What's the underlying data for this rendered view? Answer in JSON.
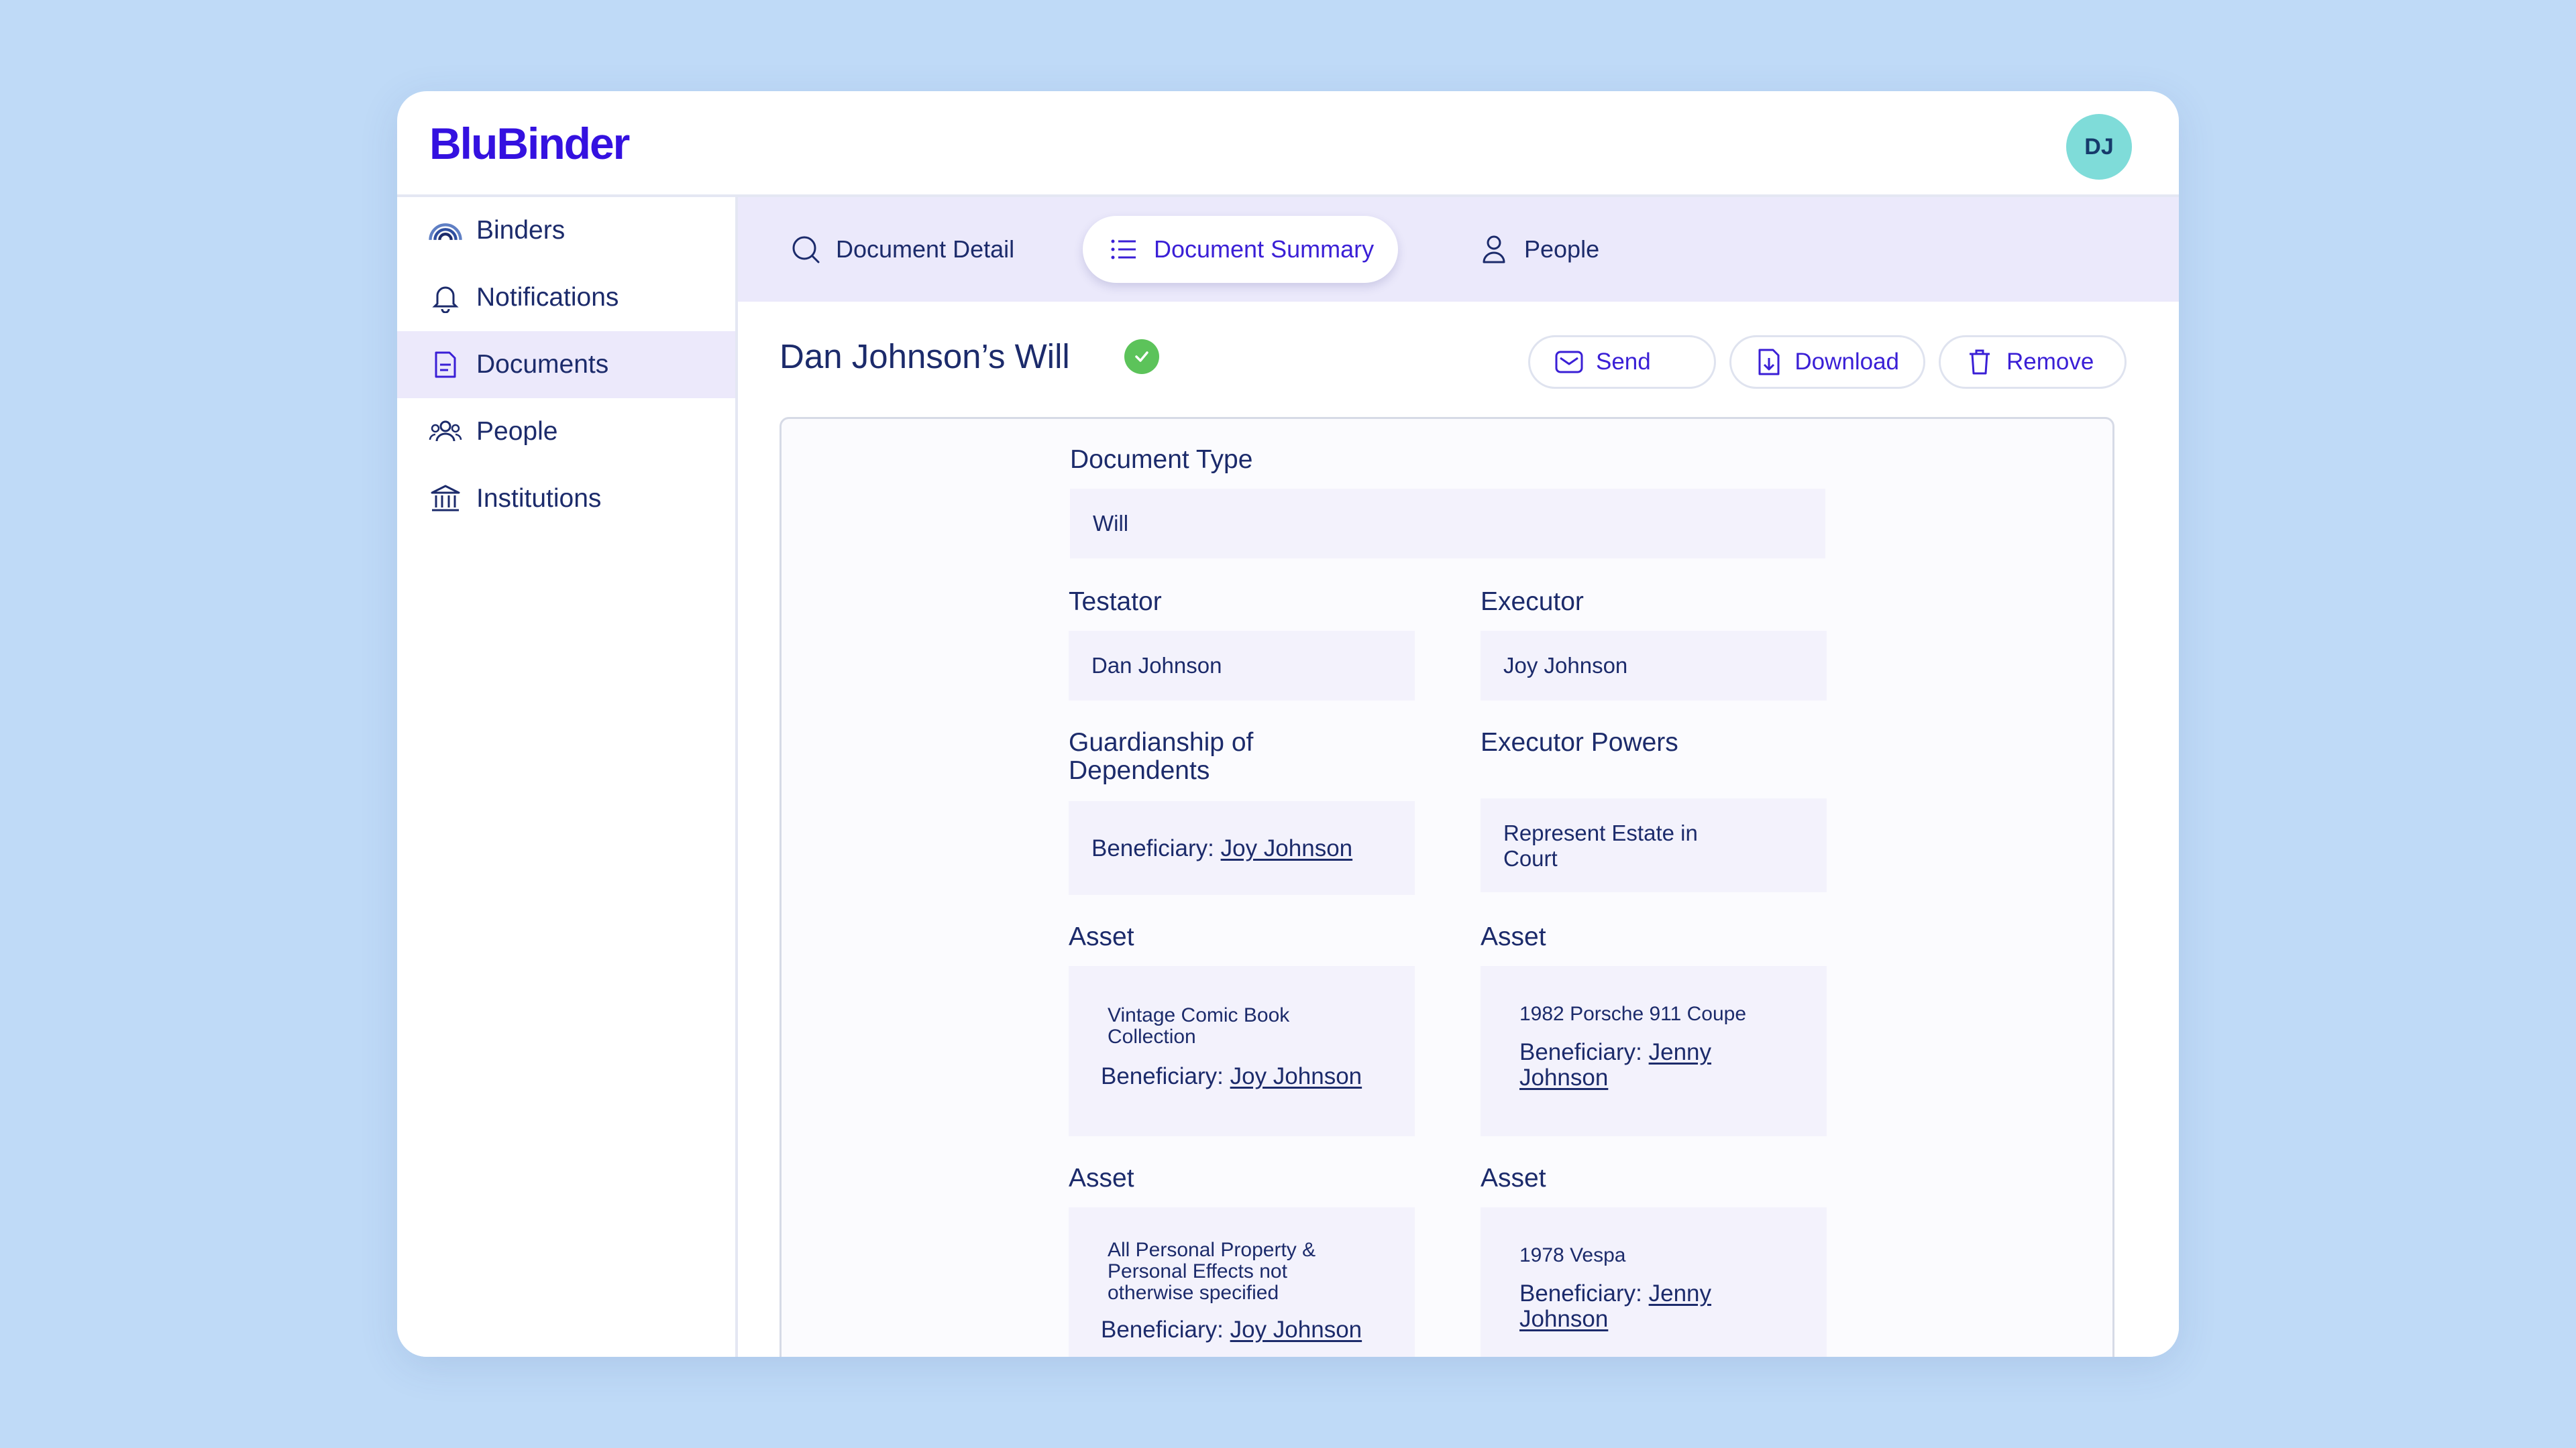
{
  "app": {
    "logo": "BluBinder",
    "avatar_initials": "DJ"
  },
  "colors": {
    "brand": "#3411e0",
    "accent": "#3a1fd6",
    "background": "#bfdaf7",
    "active_nav": "#ece9fb",
    "tabbar": "#ebe9fb",
    "field_bg": "#f3f2fc",
    "status_ok": "#5cc35a"
  },
  "sidebar": {
    "items": [
      {
        "label": "Binders",
        "icon": "rainbow-arch-icon"
      },
      {
        "label": "Notifications",
        "icon": "bell-icon"
      },
      {
        "label": "Documents",
        "icon": "document-icon",
        "active": true
      },
      {
        "label": "People",
        "icon": "group-people-icon"
      },
      {
        "label": "Institutions",
        "icon": "bank-building-icon"
      }
    ]
  },
  "tabs": [
    {
      "label": "Document Detail",
      "icon": "search-icon"
    },
    {
      "label": "Document Summary",
      "icon": "list-icon",
      "active": true
    },
    {
      "label": "People",
      "icon": "person-icon"
    }
  ],
  "document": {
    "title": "Dan Johnson’s Will",
    "status_icon": "verified-check-icon",
    "actions": {
      "send": "Send",
      "download": "Download",
      "remove": "Remove"
    }
  },
  "summary": {
    "document_type": {
      "label": "Document Type",
      "value": "Will"
    },
    "testator": {
      "label": "Testator",
      "value": "Dan Johnson"
    },
    "executor": {
      "label": "Executor",
      "value": "Joy Johnson"
    },
    "guardianship": {
      "label_line1": "Guardianship of",
      "label_line2": "Dependents",
      "beneficiary_prefix": "Beneficiary:",
      "beneficiary": "Joy Johnson"
    },
    "executor_powers": {
      "label": "Executor Powers",
      "value_line1": "Represent Estate in",
      "value_line2": "Court"
    },
    "assets": [
      {
        "label": "Asset",
        "lines": [
          "Vintage Comic Book",
          "Collection"
        ],
        "beneficiary_prefix": "Beneficiary:",
        "beneficiary_line1": "Joy Johnson",
        "beneficiary_line2": ""
      },
      {
        "label": "Asset",
        "lines": [
          "1982 Porsche 911 Coupe"
        ],
        "beneficiary_prefix": "Beneficiary:",
        "beneficiary_line1": "Jenny",
        "beneficiary_line2": "Johnson"
      },
      {
        "label": "Asset",
        "lines": [
          "All Personal Property &",
          "Personal Effects not",
          "otherwise specified"
        ],
        "beneficiary_prefix": "Beneficiary:",
        "beneficiary_line1": "Joy Johnson",
        "beneficiary_line2": ""
      },
      {
        "label": "Asset",
        "lines": [
          "1978 Vespa"
        ],
        "beneficiary_prefix": "Beneficiary:",
        "beneficiary_line1": "Jenny",
        "beneficiary_line2": "Johnson"
      }
    ]
  }
}
